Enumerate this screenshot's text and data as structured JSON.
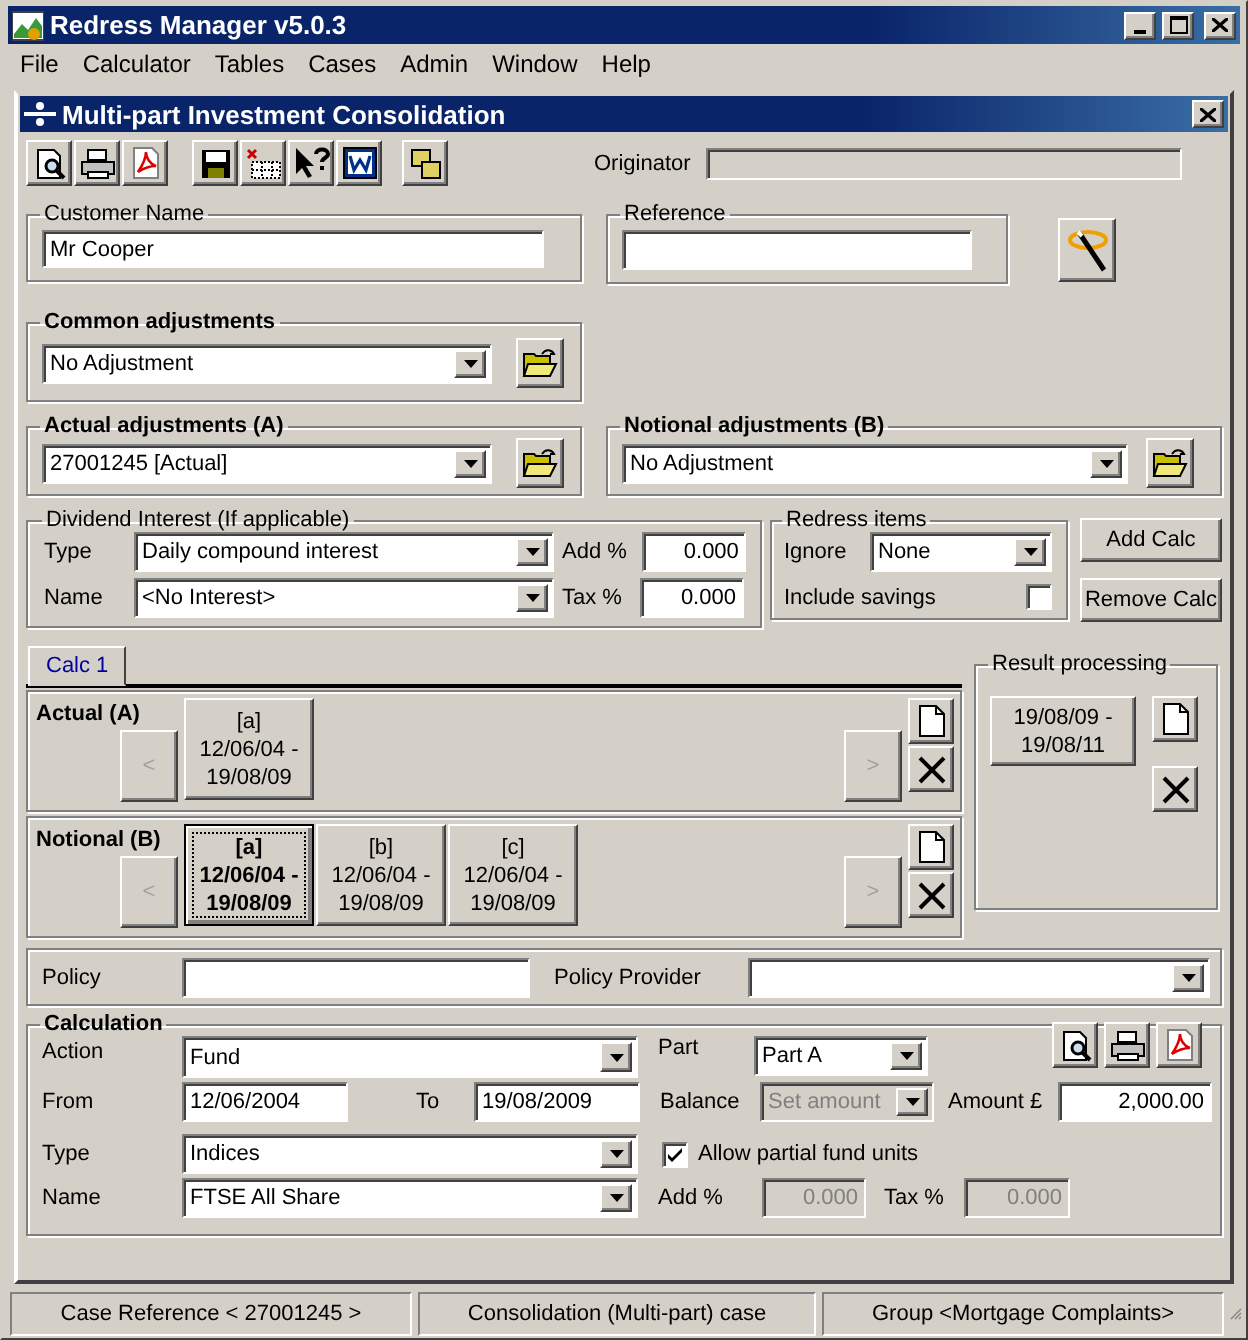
{
  "window": {
    "title": "Redress Manager v5.0.3"
  },
  "menu": [
    "File",
    "Calculator",
    "Tables",
    "Cases",
    "Admin",
    "Window",
    "Help"
  ],
  "document": {
    "title": "Multi-part Investment Consolidation"
  },
  "originator": {
    "label": "Originator",
    "disabled": true
  },
  "customer_name": {
    "legend": "Customer Name",
    "value": "Mr Cooper"
  },
  "reference": {
    "legend": "Reference"
  },
  "common_adjustments": {
    "legend": "Common adjustments",
    "value": "No Adjustment"
  },
  "actual_adjustments": {
    "legend": "Actual adjustments (A)",
    "value": "27001245 [Actual]"
  },
  "notional_adjustments": {
    "legend": "Notional adjustments (B)",
    "value": "No Adjustment"
  },
  "dividend_interest": {
    "legend": "Dividend Interest (If applicable)",
    "type": {
      "label": "Type",
      "value": "Daily compound interest"
    },
    "name": {
      "label": "Name",
      "value": "<No Interest>"
    },
    "add": {
      "label": "Add %",
      "value": "0.000"
    },
    "tax": {
      "label": "Tax %",
      "value": "0.000"
    }
  },
  "redress_items": {
    "legend": "Redress items",
    "ignore": {
      "label": "Ignore",
      "value": "None"
    },
    "include_savings": {
      "label": "Include savings",
      "checked": false
    }
  },
  "buttons": [
    "Add Calc",
    "Remove Calc"
  ],
  "tabs": [
    {
      "label": "Calc 1",
      "selected": true
    }
  ],
  "parts": [
    {
      "label": "Actual (A)",
      "prev": {
        "label": "<",
        "disabled": true
      },
      "next": {
        "label": ">",
        "disabled": true
      },
      "periods": [
        {
          "lines": [
            "[a]",
            "12/06/04 -",
            "19/08/09"
          ],
          "selected": false
        }
      ]
    },
    {
      "label": "Notional (B)",
      "prev": {
        "label": "<",
        "disabled": true
      },
      "next": {
        "label": ">",
        "disabled": true
      },
      "periods": [
        {
          "lines": [
            "[a]",
            "12/06/04 -",
            "19/08/09"
          ],
          "selected": true
        },
        {
          "lines": [
            "[b]",
            "12/06/04 -",
            "19/08/09"
          ],
          "selected": false
        },
        {
          "lines": [
            "[c]",
            "12/06/04 -",
            "19/08/09"
          ],
          "selected": false
        }
      ]
    }
  ],
  "result_processing": {
    "legend": "Result processing",
    "period": {
      "lines": [
        "19/08/09 -",
        "19/08/11"
      ]
    }
  },
  "policy": {
    "label": "Policy"
  },
  "policy_provider": {
    "label": "Policy Provider"
  },
  "calculation": {
    "legend": "Calculation",
    "action": {
      "label": "Action",
      "value": "Fund"
    },
    "from": {
      "label": "From",
      "value": "12/06/2004"
    },
    "to": {
      "label": "To",
      "value": "19/08/2009"
    },
    "type": {
      "label": "Type",
      "value": "Indices"
    },
    "name": {
      "label": "Name",
      "value": "FTSE All Share"
    },
    "part": {
      "label": "Part",
      "value": "Part A"
    },
    "balance": {
      "label": "Balance",
      "value": "Set amount",
      "disabled": true
    },
    "amount": {
      "label": "Amount £",
      "value": "2,000.00"
    },
    "allow_partial_units": {
      "label": "Allow partial fund units",
      "checked": true
    },
    "add": {
      "label": "Add %",
      "value": "0.000",
      "disabled": true
    },
    "tax": {
      "label": "Tax %",
      "value": "0.000",
      "disabled": true
    }
  },
  "status_bar": [
    "Case Reference < 27001245 >",
    "Consolidation (Multi-part) case",
    "Group <Mortgage Complaints>"
  ]
}
